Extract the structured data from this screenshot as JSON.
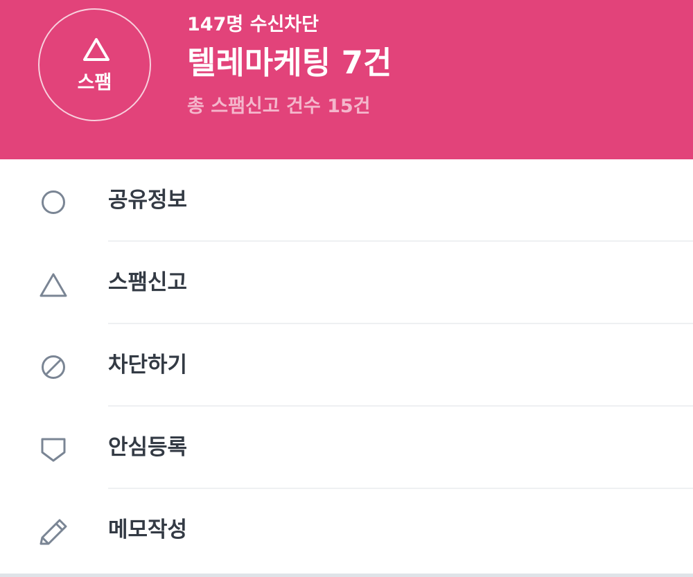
{
  "header": {
    "background_color": "#e2437a",
    "badge": {
      "icon": "warning-triangle-icon",
      "label": "스팸"
    },
    "blocked_count": "147명 수신차단",
    "category_title": "텔레마케팅 7건",
    "total_report": "총 스팸신고 건수 15건"
  },
  "menu": {
    "items": [
      {
        "label": "공유정보",
        "icon": "circle-icon"
      },
      {
        "label": "스팸신고",
        "icon": "triangle-icon"
      },
      {
        "label": "차단하기",
        "icon": "block-icon"
      },
      {
        "label": "안심등록",
        "icon": "shield-icon"
      },
      {
        "label": "메모작성",
        "icon": "pencil-icon"
      }
    ],
    "icon_color": "#7a8594",
    "text_color": "#333a44"
  }
}
